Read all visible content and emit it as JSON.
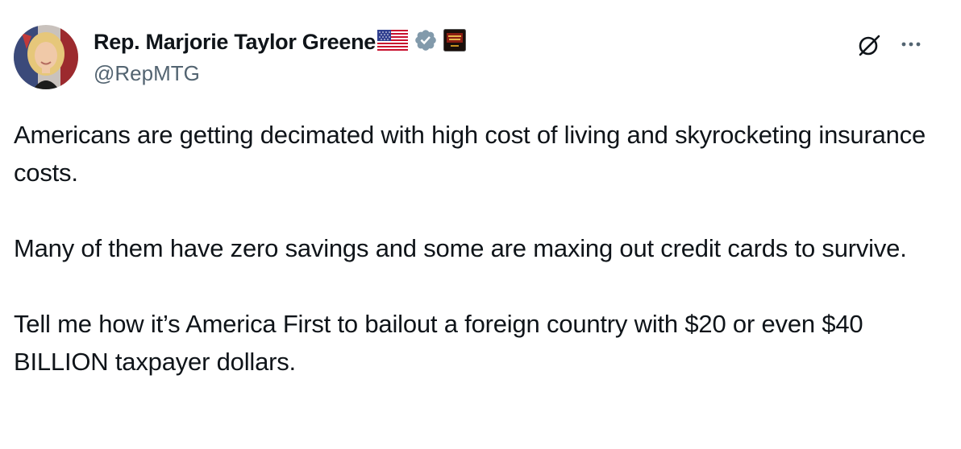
{
  "author": {
    "display_name": "Rep. Marjorie Taylor Greene",
    "handle": "@RepMTG",
    "badges": [
      "us-flag-icon",
      "verified-badge-icon",
      "affiliate-badge-icon"
    ],
    "verified_color": "#829aab"
  },
  "actions": {
    "grok": "grok-icon",
    "more": "more-icon"
  },
  "tweet": {
    "paragraphs": [
      "Americans are getting decimated with high cost of living and skyrocketing insurance costs.",
      "Many of them have zero savings and some are maxing out credit cards to survive.",
      "Tell me how it’s America First to bailout a foreign country with $20 or even $40 BILLION taxpayer dollars."
    ]
  }
}
